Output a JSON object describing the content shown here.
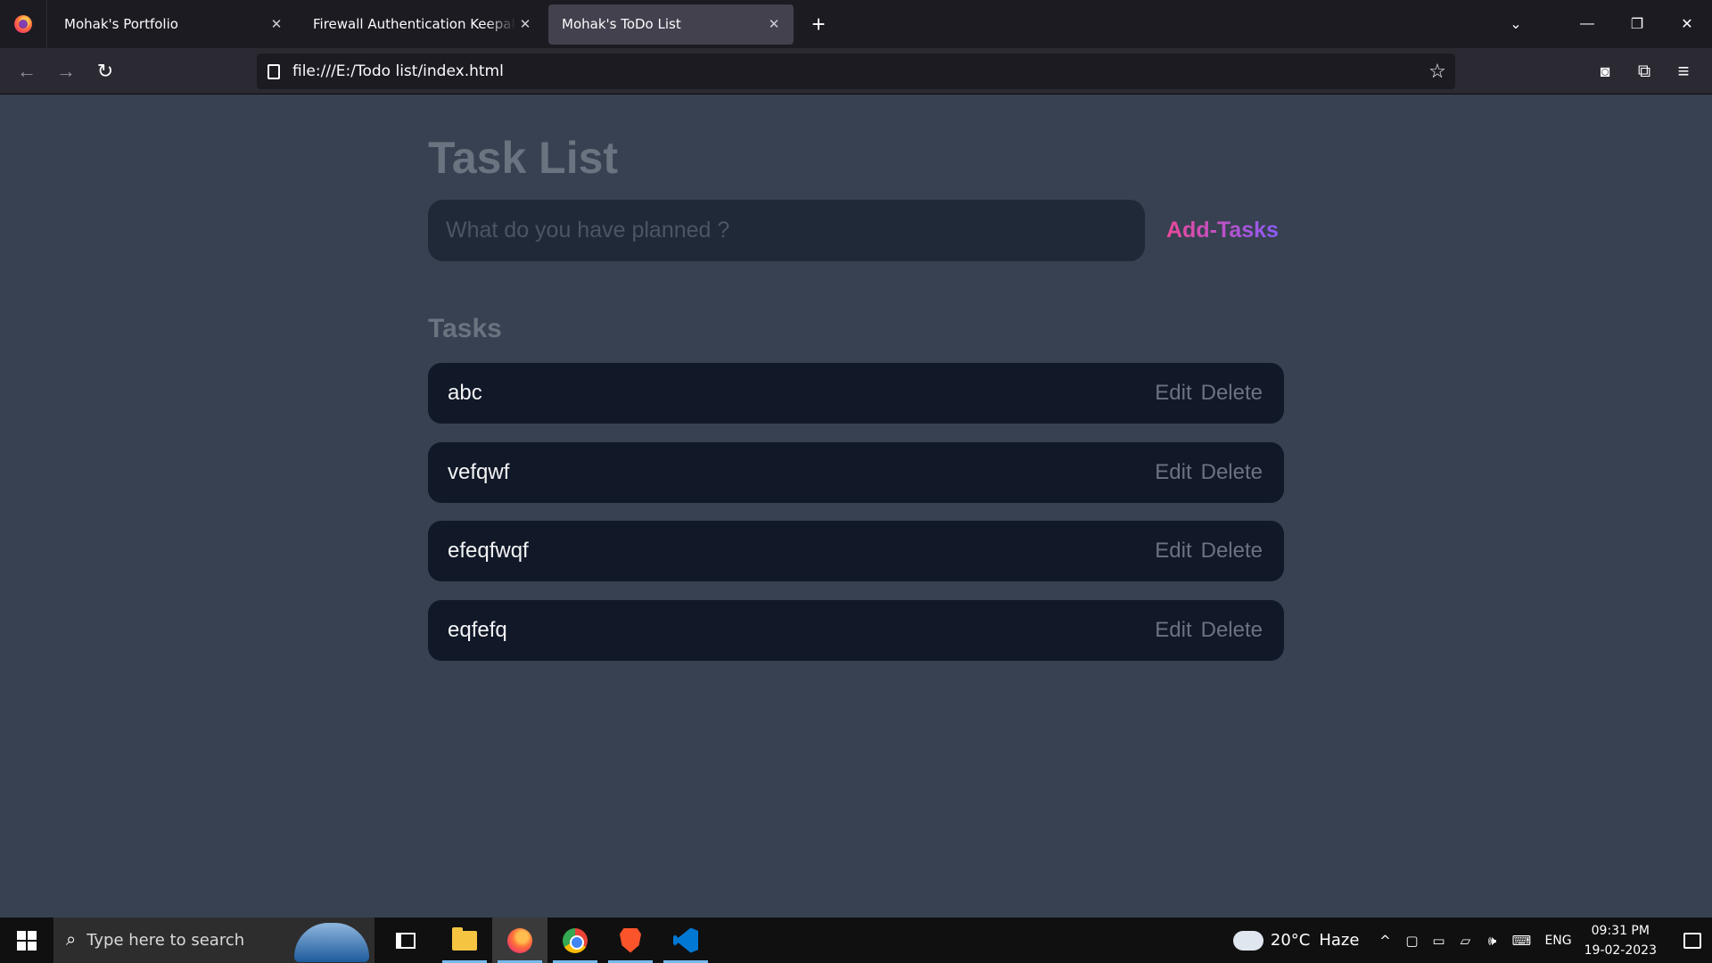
{
  "browser": {
    "tabs": [
      {
        "label": "Mohak's Portfolio",
        "active": false
      },
      {
        "label": "Firewall Authentication Keepalive W",
        "active": false
      },
      {
        "label": "Mohak's ToDo List",
        "active": true
      }
    ],
    "new_tab_icon": "plus-icon",
    "url": "file:///E:/Todo list/index.html"
  },
  "app": {
    "title": "Task List",
    "input": {
      "placeholder": "What do you have planned ?",
      "value": ""
    },
    "add_button_label": "Add-Tasks",
    "tasks_heading": "Tasks",
    "tasks": [
      {
        "text": "abc",
        "edit_label": "Edit",
        "delete_label": "Delete"
      },
      {
        "text": "vefqwf",
        "edit_label": "Edit",
        "delete_label": "Delete"
      },
      {
        "text": "efeqfwqf",
        "edit_label": "Edit",
        "delete_label": "Delete"
      },
      {
        "text": "eqfefq",
        "edit_label": "Edit",
        "delete_label": "Delete"
      }
    ],
    "colors": {
      "background": "#374151",
      "card": "#111827",
      "input": "#1f2937",
      "accent_start": "#ec4899",
      "accent_end": "#8b5cf6"
    }
  },
  "taskbar": {
    "search_placeholder": "Type here to search",
    "pinned": [
      "task-view-icon",
      "file-explorer-icon",
      "firefox-icon",
      "chrome-icon",
      "brave-icon",
      "vscode-icon"
    ],
    "weather": {
      "temp": "20°C",
      "condition": "Haze"
    },
    "language": "ENG",
    "time": "09:31 PM",
    "date": "19-02-2023"
  }
}
